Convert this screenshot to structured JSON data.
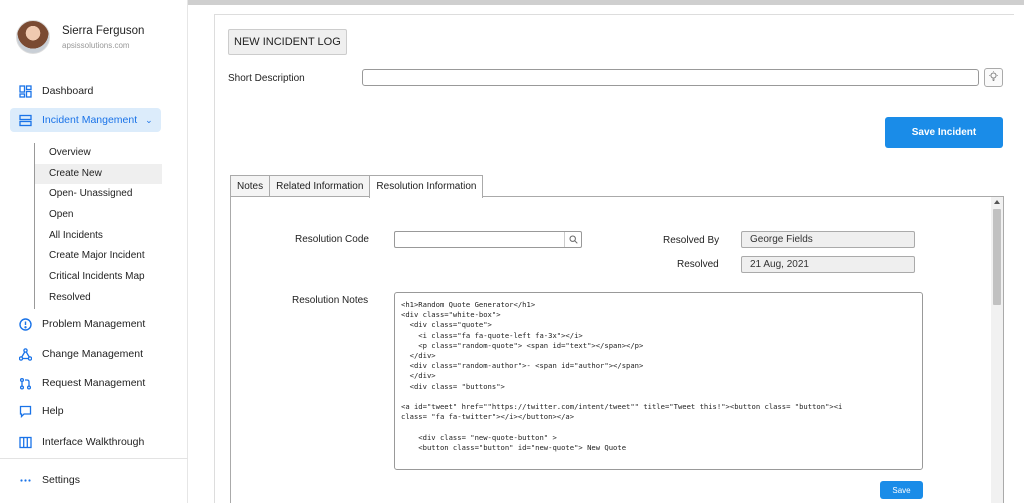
{
  "user": {
    "name": "Sierra Ferguson",
    "org": "apsissolutions.com"
  },
  "nav": {
    "dashboard": "Dashboard",
    "incident": "Incident Mangement",
    "problem": "Problem Management",
    "change": "Change Management",
    "request": "Request Management",
    "help": "Help",
    "walkthrough": "Interface Walkthrough",
    "settings": "Settings"
  },
  "incident_sub": [
    "Overview",
    "Create New",
    "Open- Unassigned",
    "Open",
    "All Incidents",
    "Create Major Incident",
    "Critical Incidents Map",
    "Resolved"
  ],
  "form": {
    "title": "NEW INCIDENT LOG",
    "short_desc_label": "Short Description",
    "short_desc_value": "",
    "save_incident": "Save Incident"
  },
  "tabs": [
    "Notes",
    "Related Information",
    "Resolution Information"
  ],
  "resolution": {
    "code_label": "Resolution Code",
    "code_value": "",
    "resolved_by_label": "Resolved By",
    "resolved_by_value": "George Fields",
    "resolved_label": "Resolved",
    "resolved_value": "21 Aug, 2021",
    "notes_label": "Resolution Notes",
    "notes_value": "<h1>Random Quote Generator</h1>\n<div class=\"white-box\">\n  <div class=\"quote\">\n    <i class=\"fa fa-quote-left fa-3x\"></i>\n    <p class=\"random-quote\"> <span id=\"text\"></span></p>\n  </div>\n  <div class=\"random-author\">- <span id=\"author\"></span>\n  </div>\n  <div class= \"buttons\">\n\n<a id=\"tweet\" href=\"\"https://twitter.com/intent/tweet\"\" title=\"Tweet this!\"><button class= \"button\"><i\nclass= \"fa fa-twitter\"></i></button></a>\n\n    <div class= \"new-quote-button\" >\n    <button class=\"button\" id=\"new-quote\"> New Quote",
    "save": "Save"
  },
  "colors": {
    "accent": "#1a8ce8",
    "nav_active_bg": "#dcecfb"
  }
}
